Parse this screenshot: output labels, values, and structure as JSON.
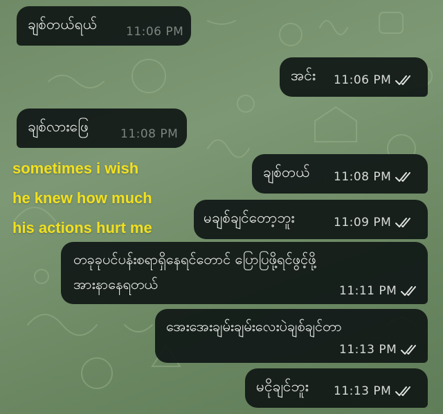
{
  "messages": [
    {
      "id": "m1",
      "dir": "in",
      "text": "ချစ်တယ်ရယ်",
      "time": "11:06 PM"
    },
    {
      "id": "m2",
      "dir": "out",
      "text": "အင်း",
      "time": "11:06 PM"
    },
    {
      "id": "m3",
      "dir": "in",
      "text": "ချစ်လားဖြေ",
      "time": "11:08 PM"
    },
    {
      "id": "m4",
      "dir": "out",
      "text": "ချစ်တယ်",
      "time": "11:08 PM"
    },
    {
      "id": "m5",
      "dir": "out",
      "text": "မချစ်ချင်တော့ဘူး",
      "time": "11:09 PM"
    },
    {
      "id": "m6",
      "dir": "out",
      "text_line1": "တခုခုပင်ပန်းစရာရှိနေရင်တောင် ပြောပြဖို့ရင်ဖွင့်ဖို့",
      "text_line2": "အားနာနေရတယ်",
      "time": "11:11 PM"
    },
    {
      "id": "m7",
      "dir": "out",
      "text": "အေးအေးချမ်းချမ်းလေးပဲချစ်ချင်တာ",
      "time": "11:13 PM"
    },
    {
      "id": "m8",
      "dir": "out",
      "text": "မငိုချင်ဘူး",
      "time": "11:13 PM"
    }
  ],
  "caption": {
    "line1": "sometimes i wish",
    "line2": "he knew how much",
    "line3": "his actions hurt me"
  },
  "colors": {
    "bubble": "#101816",
    "caption": "#f2e020",
    "background": "#7d9874"
  },
  "icons": {
    "read_receipt": "double-check-icon"
  }
}
